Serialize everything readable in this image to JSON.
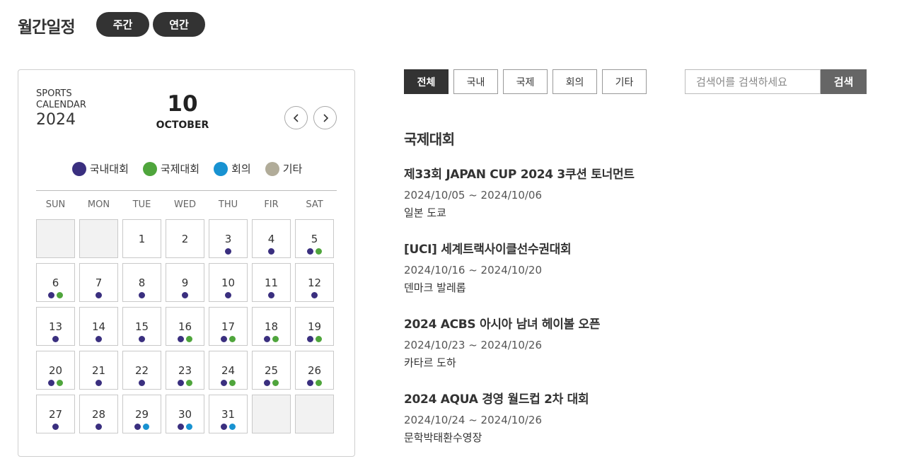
{
  "header": {
    "title": "월간일정",
    "weekly_label": "주간",
    "yearly_label": "연간"
  },
  "calendar": {
    "label": "SPORTS CALENDAR",
    "year": "2024",
    "day": "10",
    "month": "OCTOBER",
    "prev_icon": "chevron-left-icon",
    "next_icon": "chevron-right-icon",
    "legend": [
      {
        "label": "국내대회",
        "color": "#3a2f7f"
      },
      {
        "label": "국제대회",
        "color": "#4fa53c"
      },
      {
        "label": "회의",
        "color": "#1892d1"
      },
      {
        "label": "기타",
        "color": "#b1ac99"
      }
    ],
    "weekdays": [
      "SUN",
      "MON",
      "TUE",
      "WED",
      "THU",
      "FIR",
      "SAT"
    ],
    "cells": [
      {
        "day": "",
        "dots": []
      },
      {
        "day": "",
        "dots": []
      },
      {
        "day": "1",
        "dots": []
      },
      {
        "day": "2",
        "dots": []
      },
      {
        "day": "3",
        "dots": [
          "domestic"
        ]
      },
      {
        "day": "4",
        "dots": [
          "domestic"
        ]
      },
      {
        "day": "5",
        "dots": [
          "domestic",
          "international"
        ]
      },
      {
        "day": "6",
        "dots": [
          "domestic",
          "international"
        ]
      },
      {
        "day": "7",
        "dots": [
          "domestic"
        ]
      },
      {
        "day": "8",
        "dots": [
          "domestic"
        ]
      },
      {
        "day": "9",
        "dots": [
          "domestic"
        ]
      },
      {
        "day": "10",
        "dots": [
          "domestic"
        ]
      },
      {
        "day": "11",
        "dots": [
          "domestic"
        ]
      },
      {
        "day": "12",
        "dots": [
          "domestic"
        ]
      },
      {
        "day": "13",
        "dots": [
          "domestic"
        ]
      },
      {
        "day": "14",
        "dots": [
          "domestic"
        ]
      },
      {
        "day": "15",
        "dots": [
          "domestic"
        ]
      },
      {
        "day": "16",
        "dots": [
          "domestic",
          "international"
        ]
      },
      {
        "day": "17",
        "dots": [
          "domestic",
          "international"
        ]
      },
      {
        "day": "18",
        "dots": [
          "domestic",
          "international"
        ]
      },
      {
        "day": "19",
        "dots": [
          "domestic",
          "international"
        ]
      },
      {
        "day": "20",
        "dots": [
          "domestic",
          "international"
        ]
      },
      {
        "day": "21",
        "dots": [
          "domestic"
        ]
      },
      {
        "day": "22",
        "dots": [
          "domestic"
        ]
      },
      {
        "day": "23",
        "dots": [
          "domestic",
          "international"
        ]
      },
      {
        "day": "24",
        "dots": [
          "domestic",
          "international"
        ]
      },
      {
        "day": "25",
        "dots": [
          "domestic",
          "international"
        ]
      },
      {
        "day": "26",
        "dots": [
          "domestic",
          "international"
        ]
      },
      {
        "day": "27",
        "dots": [
          "domestic"
        ]
      },
      {
        "day": "28",
        "dots": [
          "domestic"
        ]
      },
      {
        "day": "29",
        "dots": [
          "domestic",
          "meeting"
        ]
      },
      {
        "day": "30",
        "dots": [
          "domestic",
          "meeting"
        ]
      },
      {
        "day": "31",
        "dots": [
          "domestic",
          "meeting"
        ]
      },
      {
        "day": "",
        "dots": []
      },
      {
        "day": "",
        "dots": []
      }
    ],
    "dot_colors": {
      "domestic": "#3a2f7f",
      "international": "#4fa53c",
      "meeting": "#1892d1",
      "other": "#b1ac99"
    }
  },
  "filters": {
    "items": [
      {
        "label": "전체",
        "active": true
      },
      {
        "label": "국내",
        "active": false
      },
      {
        "label": "국제",
        "active": false
      },
      {
        "label": "회의",
        "active": false
      },
      {
        "label": "기타",
        "active": false
      }
    ]
  },
  "search": {
    "placeholder": "검색어를 검색하세요",
    "button_label": "검색"
  },
  "section": {
    "title": "국제대회"
  },
  "events": [
    {
      "title": "제33회 JAPAN CUP 2024 3쿠션 토너먼트",
      "date": "2024/10/05 ~ 2024/10/06",
      "place": "일본 도쿄"
    },
    {
      "title": "[UCI] 세계트랙사이클선수권대회",
      "date": "2024/10/16 ~ 2024/10/20",
      "place": "덴마크 발레롭"
    },
    {
      "title": "2024 ACBS 아시아 남녀 헤이볼 오픈",
      "date": "2024/10/23 ~ 2024/10/26",
      "place": "카타르 도하"
    },
    {
      "title": "2024 AQUA 경영 월드컵 2차 대회",
      "date": "2024/10/24 ~ 2024/10/26",
      "place": "문학박태환수영장"
    }
  ]
}
